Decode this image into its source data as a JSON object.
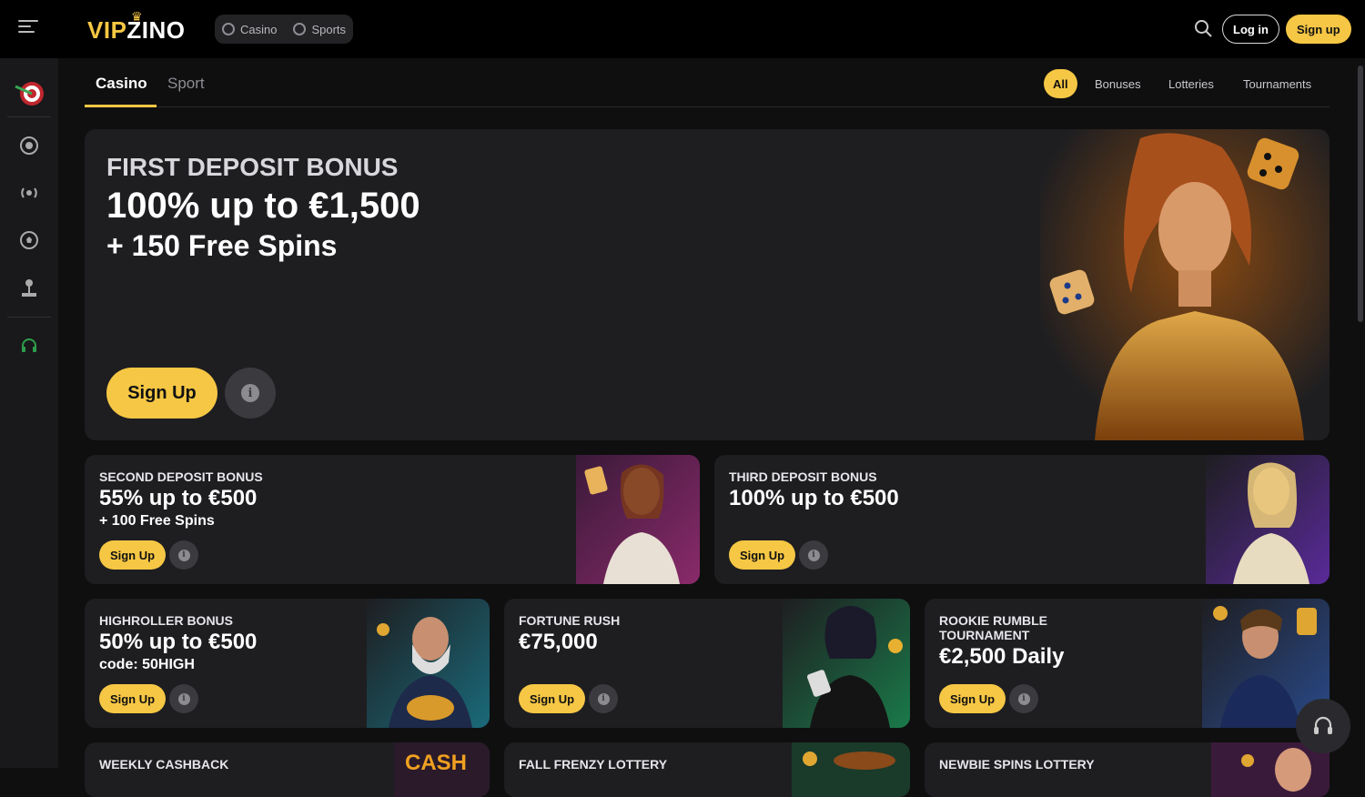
{
  "header": {
    "logo_vip": "VIP",
    "logo_zino": "ZINO",
    "mode_casino": "Casino",
    "mode_sports": "Sports",
    "login_label": "Log in",
    "signup_label": "Sign up"
  },
  "tabs": {
    "casino": "Casino",
    "sport": "Sport"
  },
  "filters": [
    "All",
    "Bonuses",
    "Lotteries",
    "Tournaments"
  ],
  "hero": {
    "label": "FIRST DEPOSIT BONUS",
    "headline": "100% up to €1,500",
    "sub": "+ 150 Free Spins",
    "button": "Sign Up"
  },
  "cards": [
    {
      "label": "SECOND DEPOSIT BONUS",
      "headline": "55% up to €500",
      "sub": "+ 100 Free Spins",
      "button": "Sign Up"
    },
    {
      "label": "THIRD DEPOSIT BONUS",
      "headline": "100% up to €500",
      "sub": "",
      "button": "Sign Up"
    },
    {
      "label": "HIGHROLLER BONUS",
      "headline": "50% up to €500",
      "sub": "code: 50HIGH",
      "button": "Sign Up"
    },
    {
      "label": "FORTUNE RUSH",
      "headline": "€75,000",
      "sub": "",
      "button": "Sign Up"
    },
    {
      "label": "ROOKIE RUMBLE TOURNAMENT",
      "headline": "€2,500 Daily",
      "sub": "",
      "button": "Sign Up"
    },
    {
      "label": "WEEKLY CASHBACK"
    },
    {
      "label": "FALL FRENZY LOTTERY"
    },
    {
      "label": "NEWBIE SPINS LOTTERY"
    }
  ],
  "colors": {
    "accent": "#f6c744",
    "card_bg": "#1e1e21",
    "page_bg": "#0f0f10"
  },
  "icons": [
    "menu-icon",
    "search-icon",
    "casino-chip-icon",
    "soccer-ball-icon",
    "target-icon",
    "live-icon",
    "joystick-icon",
    "support-headset-icon",
    "info-icon"
  ]
}
